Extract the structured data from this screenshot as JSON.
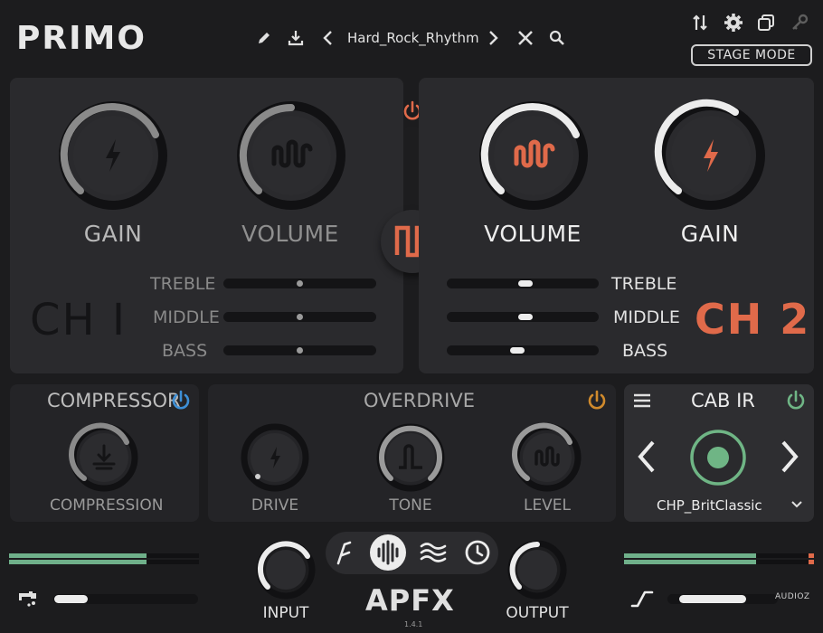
{
  "app": {
    "logo": "PRIMO",
    "brand": "APFX",
    "version": "1.4.1",
    "watermark": "AUDIOZ"
  },
  "header": {
    "preset_name": "Hard_Rock_Rhythm",
    "stage_mode_label": "STAGE MODE",
    "icons": [
      "pencil-icon",
      "download-icon",
      "chevron-left-icon",
      "chevron-right-icon",
      "close-icon",
      "search-icon",
      "routing-icon",
      "gear-icon",
      "copy-icon",
      "key-icon"
    ]
  },
  "channel1": {
    "label": "CH I",
    "active": false,
    "gain_label": "GAIN",
    "volume_label": "VOLUME",
    "gain_level": 0.72,
    "volume_level": 0.58,
    "sliders": [
      {
        "label": "TREBLE",
        "value": 0.5
      },
      {
        "label": "MIDDLE",
        "value": 0.5
      },
      {
        "label": "BASS",
        "value": 0.5
      }
    ]
  },
  "channel2": {
    "label": "CH 2",
    "active": true,
    "volume_label": "VOLUME",
    "gain_label": "GAIN",
    "volume_level": 0.72,
    "gain_level": 0.6,
    "sliders": [
      {
        "label": "TREBLE",
        "value": 0.52
      },
      {
        "label": "MIDDLE",
        "value": 0.5
      },
      {
        "label": "BASS",
        "value": 0.47
      }
    ]
  },
  "compressor": {
    "title": "COMPRESSION_SECTION",
    "label": "COMPRESSOR",
    "knob_label": "COMPRESSION",
    "power_color": "#3d8fd6"
  },
  "overdrive": {
    "title": "OVERDRIVE",
    "power_color": "#d08a2c",
    "knobs": [
      {
        "label": "DRIVE",
        "icon": "bolt-icon"
      },
      {
        "label": "TONE",
        "icon": "tone-icon"
      },
      {
        "label": "LEVEL",
        "icon": "wave-icon"
      }
    ]
  },
  "cab_ir": {
    "title": "CAB IR",
    "preset": "CHP_BritClassic",
    "power_color": "#6fb585"
  },
  "bottom": {
    "input_label": "INPUT",
    "output_label": "OUTPUT",
    "tabs": [
      "tuner-icon",
      "amp-icon",
      "eq-icon",
      "clock-icon"
    ]
  },
  "colors": {
    "accent": "#e06a4a",
    "meter": "#6fb08a",
    "panel": "#2a2a2d",
    "background": "#1c1c1e"
  }
}
